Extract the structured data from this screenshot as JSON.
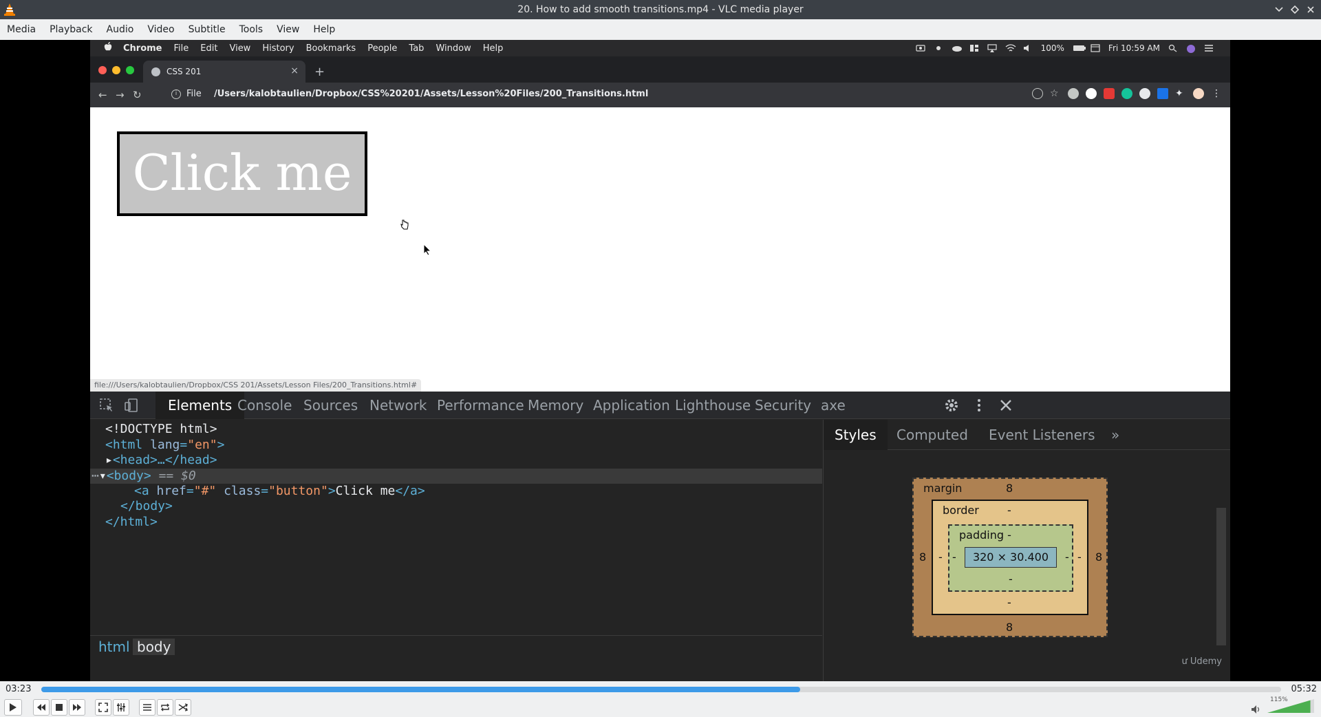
{
  "window": {
    "title": "20. How to add smooth transitions.mp4 - VLC media player",
    "icons": [
      "vlc-cone-icon",
      "minimize-icon",
      "maximize-icon",
      "close-icon"
    ]
  },
  "menubar": [
    "Media",
    "Playback",
    "Audio",
    "Video",
    "Subtitle",
    "Tools",
    "View",
    "Help"
  ],
  "mac": {
    "menus": [
      "Chrome",
      "File",
      "Edit",
      "View",
      "History",
      "Bookmarks",
      "People",
      "Tab",
      "Window",
      "Help"
    ],
    "battery": "100%",
    "clock": "Fri 10:59 AM"
  },
  "chrome": {
    "tab_title": "CSS 201",
    "tab_close": "×",
    "new_tab": "+",
    "protocol": "File",
    "url": "/Users/kalobtaulien/Dropbox/CSS%20201/Assets/Lesson%20Files/200_Transitions.html",
    "status_url": "file:///Users/kalobtaulien/Dropbox/CSS 201/Assets/Lesson Files/200_Transitions.html#"
  },
  "page": {
    "button_text": "Click me"
  },
  "devtools": {
    "tabs": [
      "Elements",
      "Console",
      "Sources",
      "Network",
      "Performance",
      "Memory",
      "Application",
      "Lighthouse",
      "Security",
      "axe"
    ],
    "active_tab": "Elements",
    "dom": {
      "doctype": "<!DOCTYPE html>",
      "html_open": "<html",
      "lang_attr": "lang",
      "lang_val": "\"en\"",
      "gt": ">",
      "head": "<head>…</head>",
      "body_open": "<body>",
      "body_ref": "== $0",
      "a_open": "<a",
      "href_attr": "href",
      "href_val": "\"#\"",
      "class_attr": "class",
      "class_val": "\"button\"",
      "a_text": "Click me",
      "a_close": "</a>",
      "body_close": "</body>",
      "html_close": "</html>",
      "eq": "="
    },
    "breadcrumbs": [
      "html",
      "body"
    ],
    "side_tabs": [
      "Styles",
      "Computed",
      "Event Listeners",
      "»"
    ],
    "box_model": {
      "margin_label": "margin",
      "margin_top": "8",
      "margin_bottom": "8",
      "margin_left": "8",
      "margin_right": "8",
      "border_label": "border",
      "border_value": "-",
      "padding_label": "padding -",
      "padding_bottom": "-",
      "content": "320 × 30.400",
      "dash": "-"
    },
    "watermark": "Udemy"
  },
  "player": {
    "time_current": "03:23",
    "time_total": "05:32",
    "progress": 0.612,
    "volume_label": "115%",
    "volume": 1.15
  },
  "colors": {
    "seek": "#3d9ae8",
    "volume": "#4caf50",
    "vlc_orange": "#f08000"
  }
}
